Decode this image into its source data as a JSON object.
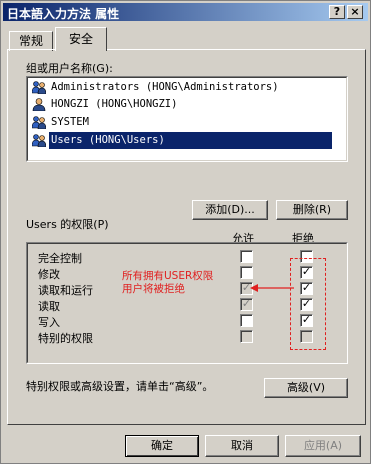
{
  "window": {
    "title": "日本語入力方法 属性",
    "help_label": "?",
    "close_label": "×"
  },
  "tabs": [
    {
      "label": "常规",
      "active": false
    },
    {
      "label": "安全",
      "active": true
    }
  ],
  "users": {
    "group_label": "组或用户名称(G):",
    "items": [
      {
        "label": "Administrators (HONG\\Administrators)",
        "icon": "users-group-icon",
        "selected": false
      },
      {
        "label": "HONGZI (HONG\\HONGZI)",
        "icon": "user-icon",
        "selected": false
      },
      {
        "label": "SYSTEM",
        "icon": "users-group-icon",
        "selected": false
      },
      {
        "label": "Users (HONG\\Users)",
        "icon": "users-group-icon",
        "selected": true
      }
    ],
    "add_label": "添加(D)...",
    "remove_label": "删除(R)"
  },
  "permissions": {
    "title": "Users 的权限(P)",
    "allow_header": "允许",
    "deny_header": "拒绝",
    "rows": [
      {
        "label": "完全控制",
        "allow": "unchecked",
        "deny": "unchecked"
      },
      {
        "label": "修改",
        "allow": "unchecked",
        "deny": "checked"
      },
      {
        "label": "读取和运行",
        "allow": "checked-disabled",
        "deny": "checked"
      },
      {
        "label": "读取",
        "allow": "checked-disabled",
        "deny": "checked"
      },
      {
        "label": "写入",
        "allow": "unchecked",
        "deny": "checked"
      },
      {
        "label": "特别的权限",
        "allow": "disabled",
        "deny": "disabled"
      }
    ]
  },
  "annotation": {
    "line1": "所有拥有USER权限",
    "line2": "用户将被拒绝",
    "color": "#e02020"
  },
  "advanced": {
    "hint": "特别权限或高级设置，请单击“高级”。",
    "button_label": "高级(V)"
  },
  "footer": {
    "ok_label": "确定",
    "cancel_label": "取消",
    "apply_label": "应用(A)"
  }
}
